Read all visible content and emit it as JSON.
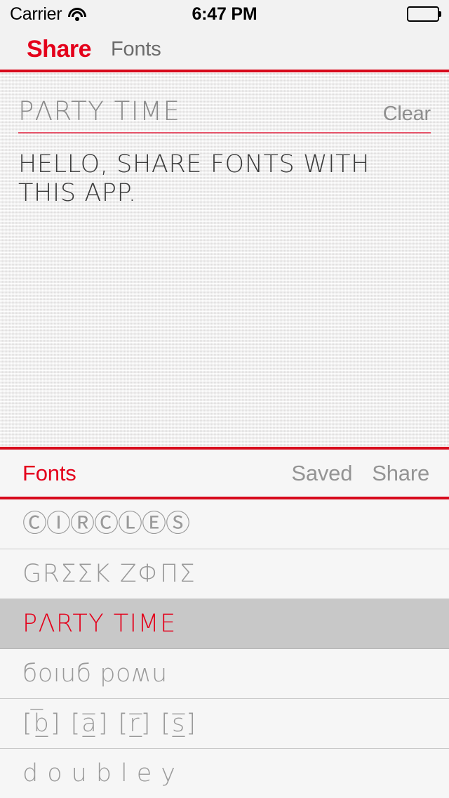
{
  "status_bar": {
    "carrier": "Carrier",
    "wifi_icon": "wifi-icon",
    "time": "6:47 PM",
    "battery_icon": "battery-full-icon"
  },
  "nav_bar": {
    "title": "Share",
    "subtitle": "Fonts",
    "accent_color": "#e4001b"
  },
  "compose": {
    "selected_font_name": "PΛRTY TIME",
    "clear_label": "Clear",
    "message": "HELLO, SHARE FONTS WITH THIS APP.",
    "underline_color": "#e8566c"
  },
  "list_toolbar": {
    "title": "Fonts",
    "saved_label": "Saved",
    "share_label": "Share"
  },
  "font_list": {
    "rows": [
      {
        "sample": "ⒸⒾⓇⒸⓁⒺⓈ",
        "name": "circles",
        "selected": false
      },
      {
        "sample": "GRΣΣK ZΦΠΣ",
        "name": "greek-zone",
        "selected": false
      },
      {
        "sample": "PΛRTY TIME",
        "name": "party-time",
        "selected": true
      },
      {
        "sample": "бoıuб poʍu",
        "name": "down-boy",
        "selected": false
      },
      {
        "sample": "[b̲̅] [a̲̅] [r̲̅] [s̲̅]",
        "name": "bars",
        "selected": false
      },
      {
        "sample": "doubley",
        "name": "doubley",
        "selected": false
      }
    ]
  },
  "colors": {
    "red": "#e4001b",
    "rule_red": "#d70a1c",
    "row_bg": "#f6f6f6",
    "row_selected_bg": "#c8c8c8",
    "muted_text": "#9a9a9a"
  }
}
